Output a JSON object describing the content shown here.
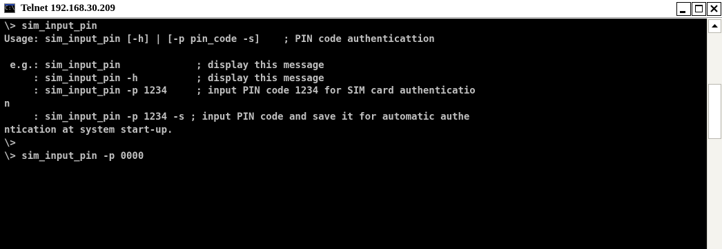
{
  "window": {
    "title": "Telnet 192.168.30.209",
    "icon_label": "C:\\"
  },
  "icons": {
    "app": "console-icon",
    "minimize": "minimize-icon",
    "maximize": "maximize-icon",
    "close": "close-icon",
    "scroll_up": "arrow-up-icon"
  },
  "colors": {
    "console_background": "#000000",
    "console_text": "#c0c0c0"
  },
  "console": {
    "lines": [
      "\\> sim_input_pin",
      "Usage: sim_input_pin [-h] | [-p pin_code -s]    ; PIN code authenticattion",
      "",
      " e.g.: sim_input_pin             ; display this message",
      "     : sim_input_pin -h          ; display this message",
      "     : sim_input_pin -p 1234     ; input PIN code 1234 for SIM card authenticatio",
      "n",
      "     : sim_input_pin -p 1234 -s ; input PIN code and save it for automatic authe",
      "ntication at system start-up.",
      "\\>",
      "\\> sim_input_pin -p 0000"
    ]
  }
}
